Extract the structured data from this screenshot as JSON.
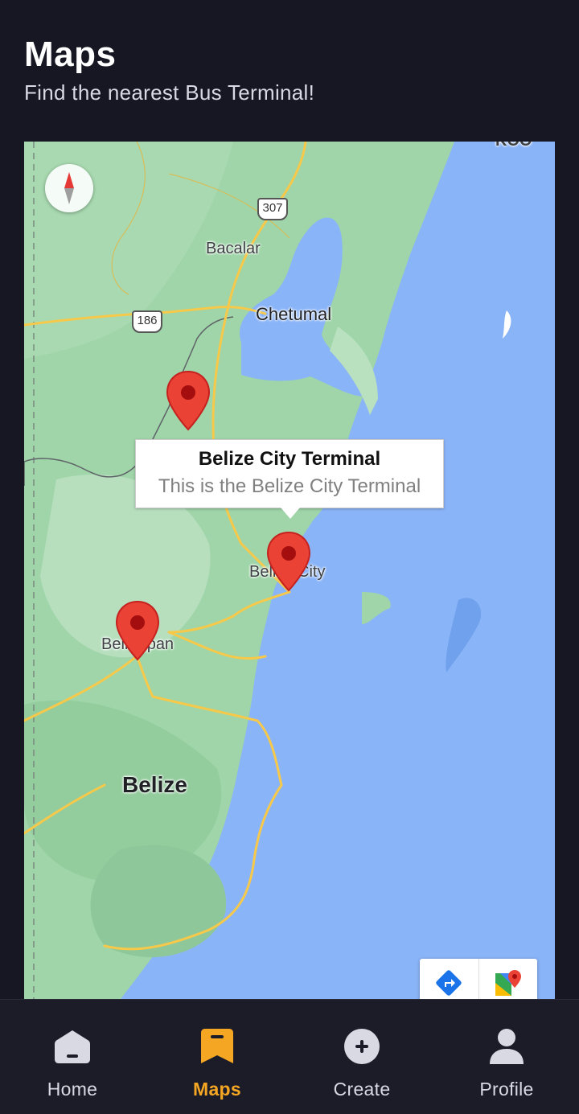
{
  "header": {
    "title": "Maps",
    "subtitle": "Find the nearest Bus Terminal!"
  },
  "map": {
    "labels": {
      "bacalar": "Bacalar",
      "chetumal": "Chetumal",
      "belize_city": "Belize City",
      "belmopan": "Belmopan",
      "country": "Belize",
      "top_edge": "KOO"
    },
    "shields": {
      "route_307": "307",
      "route_186": "186"
    },
    "callout": {
      "title": "Belize City Terminal",
      "snippet": "This is the Belize City Terminal"
    },
    "colors": {
      "water": "#8ab4f8",
      "land": "#9fd5a8",
      "road": "#f7c94b",
      "marker": "#ea4335"
    }
  },
  "nav": {
    "items": [
      {
        "label": "Home",
        "icon": "home-icon"
      },
      {
        "label": "Maps",
        "icon": "maps-bookmark-icon",
        "active": true
      },
      {
        "label": "Create",
        "icon": "plus-circle-icon"
      },
      {
        "label": "Profile",
        "icon": "person-icon"
      }
    ],
    "active_color": "#f5a623"
  }
}
